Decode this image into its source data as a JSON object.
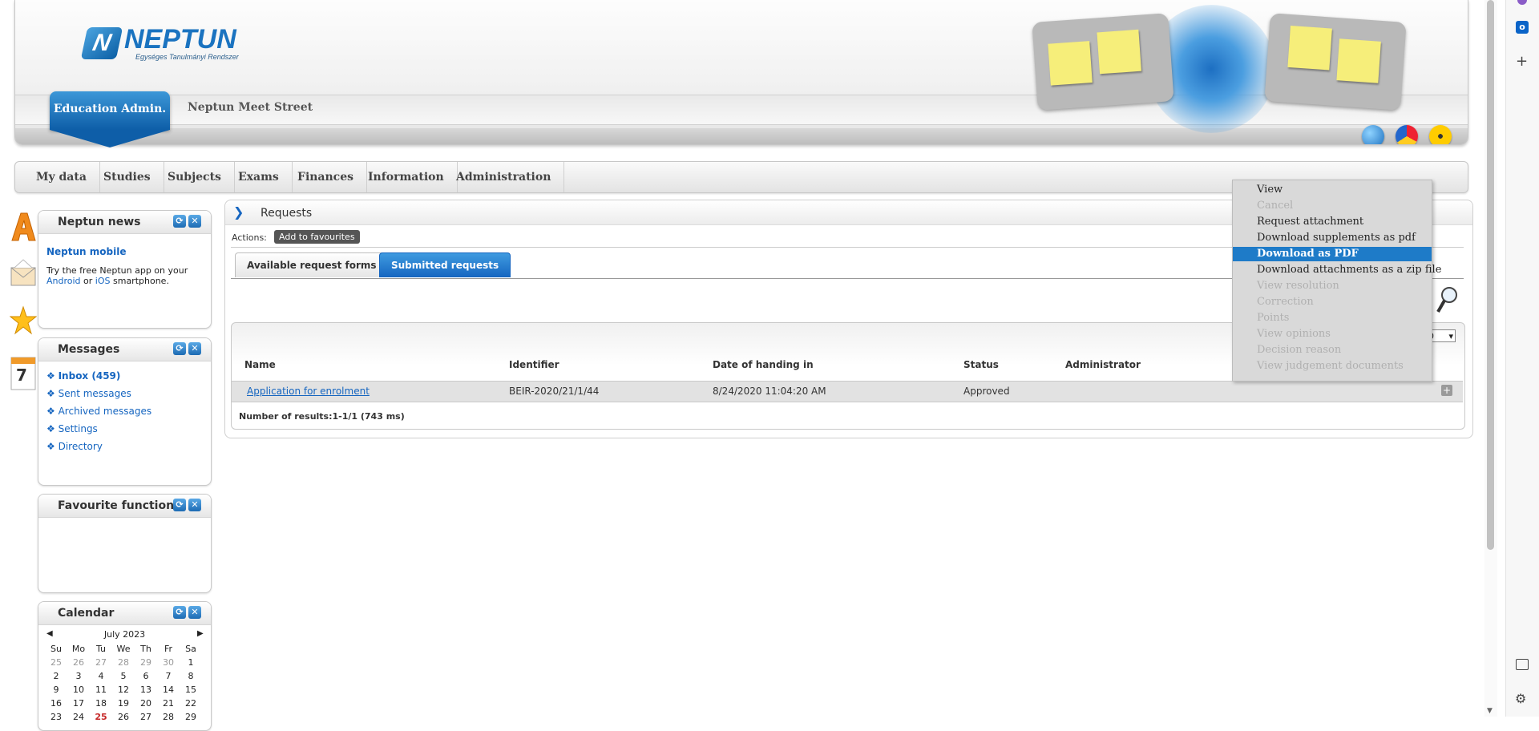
{
  "header": {
    "logo_word": "NEPTUN",
    "logo_subtitle": "Egységes Tanulmányi Rendszer",
    "tab_active": "Education Admin.",
    "tab_other": "Neptun Meet Street"
  },
  "menu": [
    "My data",
    "Studies",
    "Subjects",
    "Exams",
    "Finances",
    "Information",
    "Administration"
  ],
  "left_icons": {
    "calendar_day": "7"
  },
  "news": {
    "title": "Neptun news",
    "heading": "Neptun mobile",
    "text1": "Try the free Neptun app on your",
    "android": "Android",
    "or": "or",
    "ios": "iOS",
    "text2": "smartphone."
  },
  "messages": {
    "title": "Messages",
    "items": [
      "Inbox (459)",
      "Sent messages",
      "Archived messages",
      "Settings",
      "Directory"
    ]
  },
  "favourites": {
    "title": "Favourite functions"
  },
  "calendar": {
    "title": "Calendar",
    "month": "July 2023",
    "days": [
      "Su",
      "Mo",
      "Tu",
      "We",
      "Th",
      "Fr",
      "Sa"
    ],
    "weeks": [
      [
        "25",
        "26",
        "27",
        "28",
        "29",
        "30",
        "1"
      ],
      [
        "2",
        "3",
        "4",
        "5",
        "6",
        "7",
        "8"
      ],
      [
        "9",
        "10",
        "11",
        "12",
        "13",
        "14",
        "15"
      ],
      [
        "16",
        "17",
        "18",
        "19",
        "20",
        "21",
        "22"
      ],
      [
        "23",
        "24",
        "25",
        "26",
        "27",
        "28",
        "29"
      ]
    ]
  },
  "requests": {
    "title": "Requests",
    "actions_label": "Actions:",
    "add_fav": "Add to favourites",
    "tabs": [
      "Available request forms",
      "Submitted requests"
    ],
    "page_size": "20",
    "columns": [
      "Name",
      "Identifier",
      "Date of handing in",
      "Status",
      "Administrator"
    ],
    "row": {
      "name": "Application for enrolment",
      "identifier": "BEIR-2020/21/1/44",
      "date": "8/24/2020 11:04:20 AM",
      "status": "Approved",
      "administrator": ""
    },
    "results": "Number of results:1-1/1 (743 ms)"
  },
  "context_menu": {
    "items": [
      {
        "label": "View",
        "state": "enabled"
      },
      {
        "label": "Cancel",
        "state": "disabled"
      },
      {
        "label": "Request attachment",
        "state": "enabled"
      },
      {
        "label": "Download supplements as pdf",
        "state": "enabled"
      },
      {
        "label": "Download as PDF",
        "state": "selected"
      },
      {
        "label": "Download attachments as a zip file",
        "state": "enabled"
      },
      {
        "label": "View resolution",
        "state": "disabled"
      },
      {
        "label": "Correction",
        "state": "disabled"
      },
      {
        "label": "Points",
        "state": "disabled"
      },
      {
        "label": "View opinions",
        "state": "disabled"
      },
      {
        "label": "Decision reason",
        "state": "disabled"
      },
      {
        "label": "View judgement documents",
        "state": "disabled"
      }
    ]
  },
  "colors": {
    "accent": "#1e7bc8",
    "link": "#1565c0",
    "selected_menu": "#1e7bc8"
  }
}
